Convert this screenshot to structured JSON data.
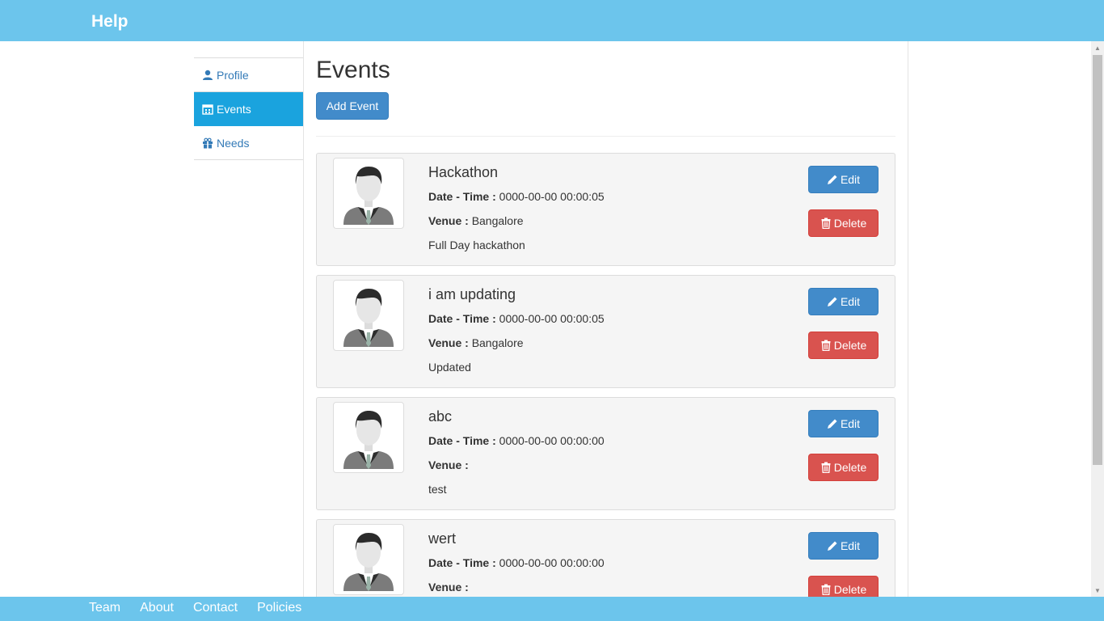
{
  "header": {
    "brand": "Help"
  },
  "sidebar": {
    "items": [
      {
        "label": "Profile",
        "icon": "user-icon",
        "active": false
      },
      {
        "label": "Events",
        "icon": "calendar-icon",
        "active": true
      },
      {
        "label": "Needs",
        "icon": "gift-icon",
        "active": false
      }
    ]
  },
  "main": {
    "title": "Events",
    "add_button": "Add Event"
  },
  "event_labels": {
    "datetime": "Date - Time :",
    "venue": "Venue :",
    "edit": "Edit",
    "delete": "Delete"
  },
  "events": [
    {
      "title": "Hackathon",
      "datetime": "0000-00-00 00:00:05",
      "venue": "Bangalore",
      "description": "Full Day hackathon"
    },
    {
      "title": "i am updating",
      "datetime": "0000-00-00 00:00:05",
      "venue": "Bangalore",
      "description": "Updated"
    },
    {
      "title": "abc",
      "datetime": "0000-00-00 00:00:00",
      "venue": "",
      "description": "test"
    },
    {
      "title": "wert",
      "datetime": "0000-00-00 00:00:00",
      "venue": "",
      "description": ""
    }
  ],
  "footer": {
    "links": [
      "Team",
      "About",
      "Contact",
      "Policies"
    ]
  },
  "colors": {
    "header": "#6cc5ec",
    "active": "#1aa3de",
    "primary": "#428bca",
    "danger": "#d9534f"
  }
}
